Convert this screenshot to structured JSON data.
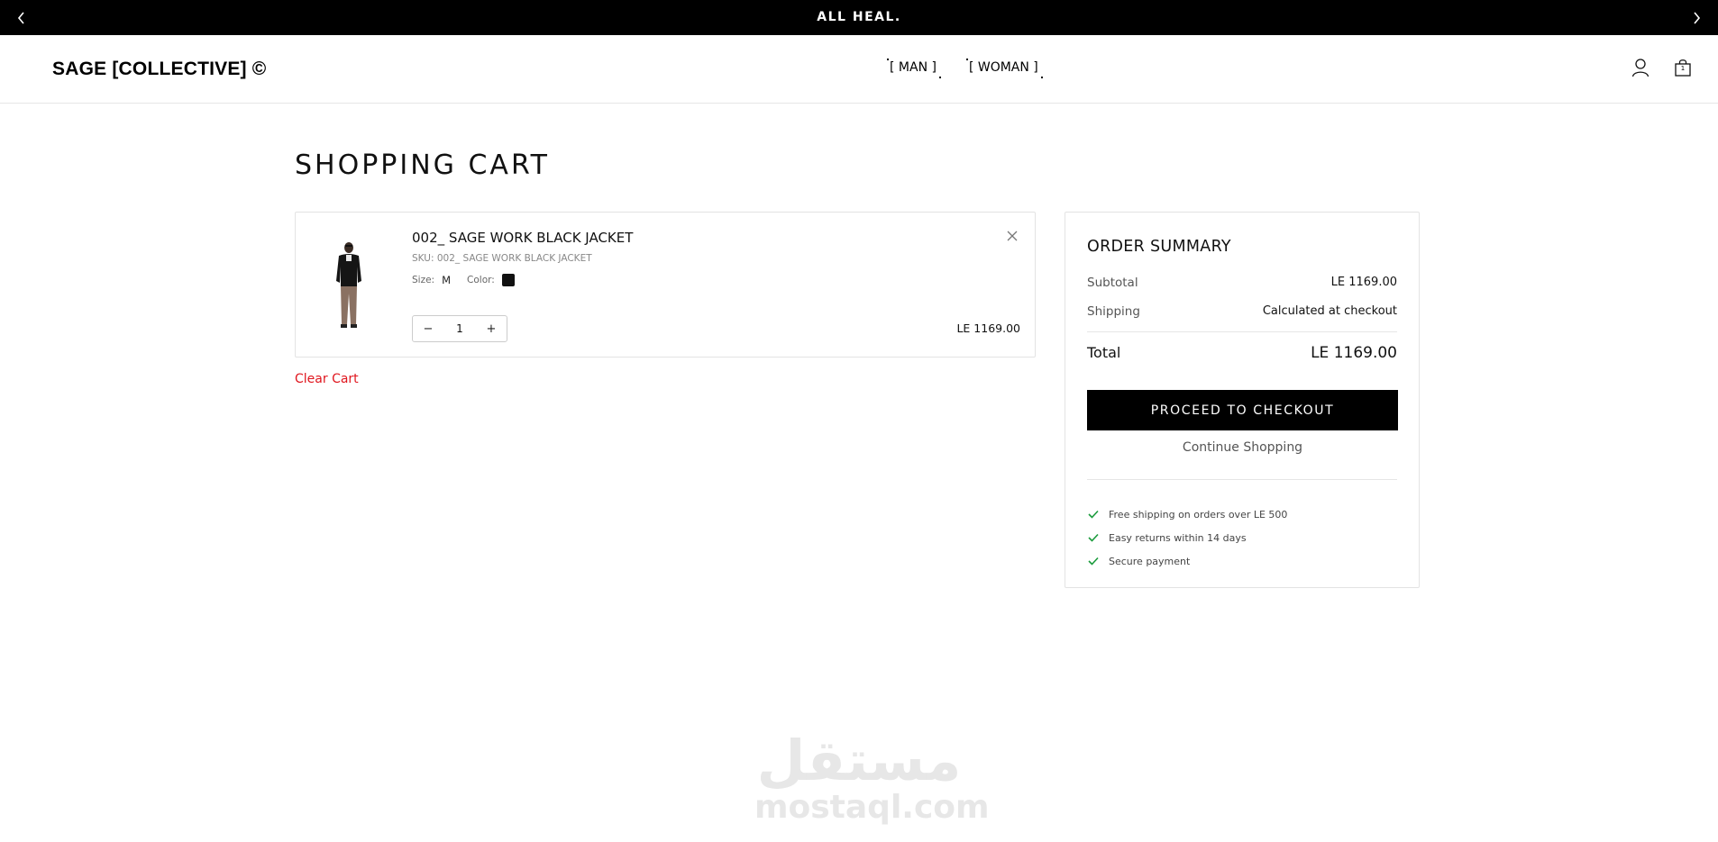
{
  "announcement": {
    "text": "ALL HEAL."
  },
  "header": {
    "logo": "SAGE [COLLECTIVE] ©",
    "nav": [
      {
        "label": "[ MAN ]"
      },
      {
        "label": "[ WOMAN ]"
      }
    ],
    "cart_count": "1"
  },
  "page": {
    "title": "SHOPPING CART"
  },
  "cart": {
    "items": [
      {
        "name": "002_ SAGE WORK BLACK JACKET",
        "sku": "SKU: 002_ SAGE WORK BLACK JACKET",
        "size_label": "Size:",
        "size": "M",
        "color_label": "Color:",
        "color_hex": "#111111",
        "quantity": "1",
        "decrement": "−",
        "increment": "+",
        "price": "LE 1169.00"
      }
    ],
    "clear_label": "Clear Cart"
  },
  "summary": {
    "title": "ORDER SUMMARY",
    "subtotal_label": "Subtotal",
    "subtotal": "LE 1169.00",
    "shipping_label": "Shipping",
    "shipping": "Calculated at checkout",
    "total_label": "Total",
    "total": "LE 1169.00",
    "checkout_label": "PROCEED TO CHECKOUT",
    "continue_label": "Continue Shopping",
    "perks": [
      "Free shipping on orders over LE 500",
      "Easy returns within 14 days",
      "Secure payment"
    ]
  },
  "watermark": {
    "arabic": "مستقل",
    "latin": "mostaql.com"
  },
  "colors": {
    "accent": "#000000",
    "danger": "#e0161e",
    "check": "#1a9b3c"
  }
}
